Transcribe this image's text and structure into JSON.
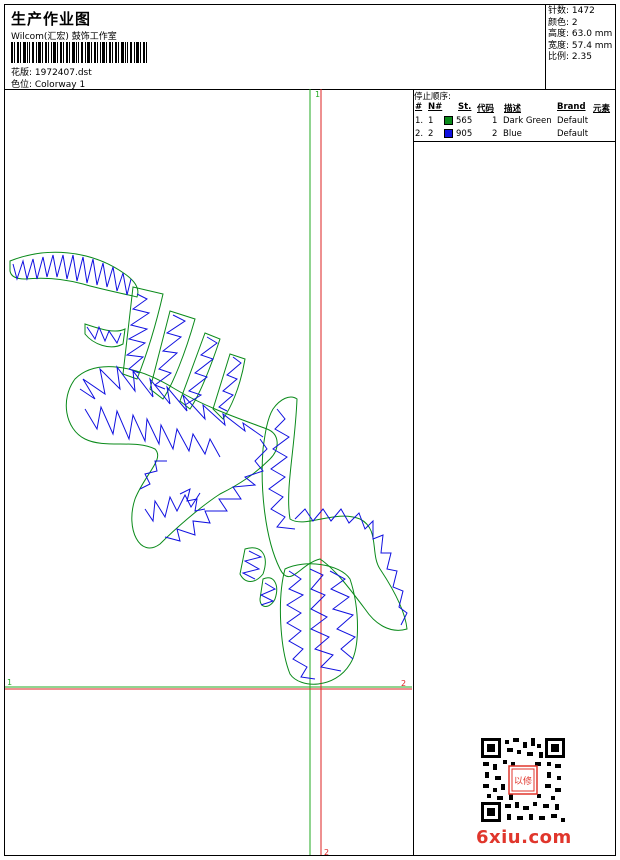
{
  "header": {
    "title": "生产作业图",
    "company": "Wilcom(汇宏) 鼓饰工作室",
    "design_label": "花版: 1972407.dst",
    "colorway_label": "色位: Colorway 1"
  },
  "stats": {
    "stitches": "针数: 1472",
    "colors": "颜色: 2",
    "height": "高度: 63.0 mm",
    "width": "宽度: 57.4 mm",
    "ratio": "比例: 2.35"
  },
  "stop_sequence": {
    "title": "停止顺序:",
    "headers": {
      "hash": "#",
      "n": "N#",
      "st": "St.",
      "code": "代码",
      "desc": "描述",
      "brand": "Brand",
      "element": "元素"
    },
    "rows": [
      {
        "num": "1.",
        "n": "1",
        "st": "565",
        "code": "1",
        "desc": "Dark Green",
        "brand": "Default",
        "color": "#0a8a1a"
      },
      {
        "num": "2.",
        "n": "2",
        "st": "905",
        "code": "2",
        "desc": "Blue",
        "brand": "Default",
        "color": "#1010e0"
      }
    ]
  },
  "guides": {
    "green_top": "1",
    "green_left": "1",
    "red_right": "2",
    "red_bottom": "2"
  },
  "colors": {
    "stitch_blue": "#1010e0",
    "outline_green": "#0a8a1a",
    "guide_green": "#22aa22",
    "guide_red": "#dd2222"
  },
  "watermark": {
    "text": "6xiu.com",
    "stamp_text": "以修"
  }
}
